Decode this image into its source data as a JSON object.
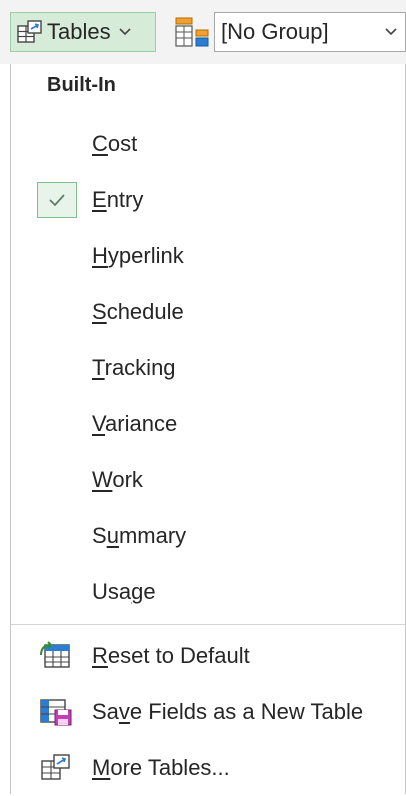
{
  "toolbar": {
    "tables_button": {
      "label": "Tables",
      "icon": "tables-icon"
    },
    "group_select": {
      "value": "[No Group]",
      "icon": "group-by-icon"
    }
  },
  "menu": {
    "section_header": "Built-In",
    "items": [
      {
        "pre": "",
        "mn": "C",
        "post": "ost",
        "checked": false
      },
      {
        "pre": "",
        "mn": "E",
        "post": "ntry",
        "checked": true
      },
      {
        "pre": "",
        "mn": "H",
        "post": "yperlink",
        "checked": false
      },
      {
        "pre": "",
        "mn": "S",
        "post": "chedule",
        "checked": false
      },
      {
        "pre": "",
        "mn": "T",
        "post": "racking",
        "checked": false
      },
      {
        "pre": "",
        "mn": "V",
        "post": "ariance",
        "checked": false
      },
      {
        "pre": "",
        "mn": "W",
        "post": "ork",
        "checked": false
      },
      {
        "pre": "S",
        "mn": "u",
        "post": "mmary",
        "checked": false
      },
      {
        "pre": "Usa",
        "mn": "g",
        "post": "e",
        "checked": false
      }
    ],
    "commands": [
      {
        "pre": "",
        "mn": "R",
        "post": "eset to Default",
        "icon": "reset-table-icon"
      },
      {
        "pre": "Sa",
        "mn": "v",
        "post": "e Fields as a New Table",
        "icon": "save-table-icon"
      },
      {
        "pre": "",
        "mn": "M",
        "post": "ore Tables...",
        "icon": "more-tables-icon"
      }
    ]
  },
  "colors": {
    "selected_bg": "#d6ecd9",
    "selected_border": "#9ccfa7",
    "check_color": "#5a7f62"
  }
}
